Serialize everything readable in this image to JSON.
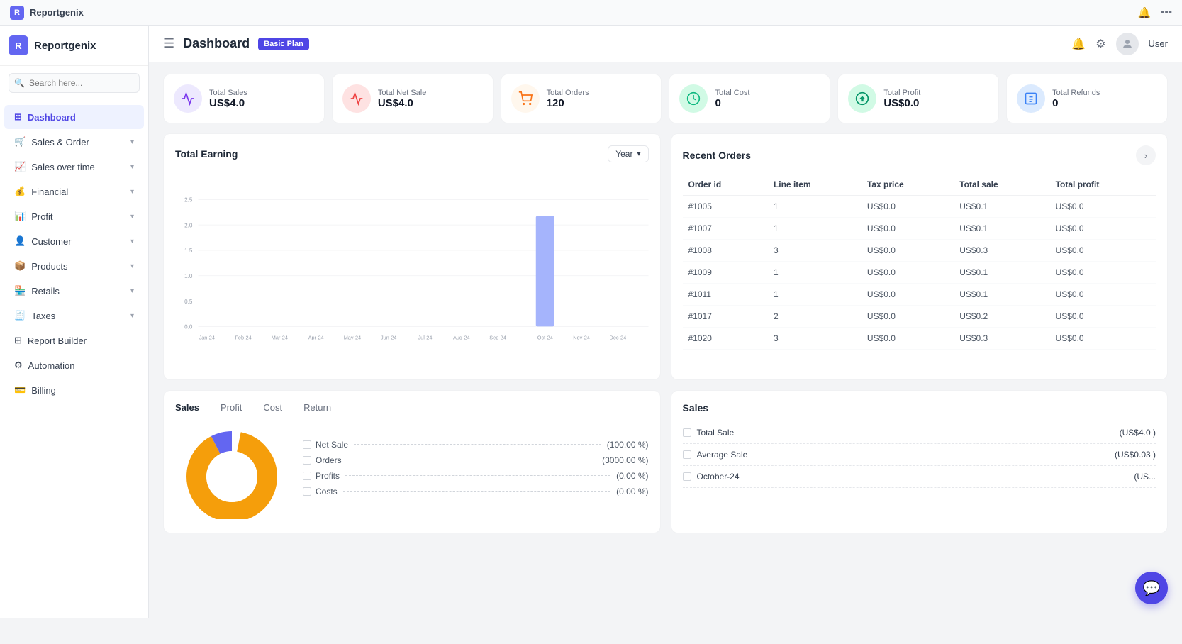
{
  "app": {
    "name": "Reportgenix",
    "logo_letter": "R"
  },
  "window_topbar": {
    "brand": "Reportgenix",
    "icons": [
      "bell",
      "dots"
    ]
  },
  "sidebar": {
    "search_placeholder": "Search here...",
    "items": [
      {
        "id": "dashboard",
        "label": "Dashboard",
        "icon": "⊞",
        "active": true,
        "has_chevron": false
      },
      {
        "id": "sales-order",
        "label": "Sales & Order",
        "icon": "🛒",
        "active": false,
        "has_chevron": true
      },
      {
        "id": "sales-over-time",
        "label": "Sales over time",
        "icon": "📈",
        "active": false,
        "has_chevron": true
      },
      {
        "id": "financial",
        "label": "Financial",
        "icon": "💰",
        "active": false,
        "has_chevron": true
      },
      {
        "id": "profit",
        "label": "Profit",
        "icon": "📊",
        "active": false,
        "has_chevron": true
      },
      {
        "id": "customer",
        "label": "Customer",
        "icon": "👤",
        "active": false,
        "has_chevron": true
      },
      {
        "id": "products",
        "label": "Products",
        "icon": "📦",
        "active": false,
        "has_chevron": true
      },
      {
        "id": "retails",
        "label": "Retails",
        "icon": "🏪",
        "active": false,
        "has_chevron": true
      },
      {
        "id": "taxes",
        "label": "Taxes",
        "icon": "🧾",
        "active": false,
        "has_chevron": true
      },
      {
        "id": "report-builder",
        "label": "Report Builder",
        "icon": "⊞",
        "active": false,
        "has_chevron": false
      },
      {
        "id": "automation",
        "label": "Automation",
        "icon": "⚙",
        "active": false,
        "has_chevron": false
      },
      {
        "id": "billing",
        "label": "Billing",
        "icon": "💳",
        "active": false,
        "has_chevron": false
      }
    ]
  },
  "topbar": {
    "hamburger": "☰",
    "title": "Dashboard",
    "plan_badge": "Basic Plan",
    "bell_icon": "🔔",
    "gear_icon": "⚙",
    "user_name": "User"
  },
  "stats": [
    {
      "id": "total-sales",
      "label": "Total Sales",
      "value": "US$4.0",
      "icon": "📊",
      "color": "purple"
    },
    {
      "id": "total-net-sale",
      "label": "Total Net Sale",
      "value": "US$4.0",
      "icon": "📣",
      "color": "red"
    },
    {
      "id": "total-orders",
      "label": "Total Orders",
      "value": "120",
      "icon": "🛒",
      "color": "orange"
    },
    {
      "id": "total-cost",
      "label": "Total Cost",
      "value": "0",
      "icon": "💵",
      "color": "green"
    },
    {
      "id": "total-profit",
      "label": "Total Profit",
      "value": "US$0.0",
      "icon": "💰",
      "color": "teal"
    },
    {
      "id": "total-refunds",
      "label": "Total Refunds",
      "value": "0",
      "icon": "📋",
      "color": "blue"
    }
  ],
  "total_earning": {
    "title": "Total Earning",
    "period_label": "Year",
    "y_labels": [
      "2.5",
      "2.0",
      "1.5",
      "1.0",
      "0.5",
      "0.0"
    ],
    "x_labels": [
      "Jan-24",
      "Feb-24",
      "Mar-24",
      "Apr-24",
      "May-24",
      "Jun-24",
      "Jul-24",
      "Aug-24",
      "Sep-24",
      "Oct-24",
      "Nov-24",
      "Dec-24"
    ],
    "bar_month": "Oct-24",
    "bar_color": "#a5b4fc"
  },
  "recent_orders": {
    "title": "Recent Orders",
    "columns": [
      "Order id",
      "Line item",
      "Tax price",
      "Total sale",
      "Total profit"
    ],
    "rows": [
      {
        "order_id": "#1005",
        "line_item": "1",
        "tax_price": "US$0.0",
        "total_sale": "US$0.1",
        "total_profit": "US$0.0"
      },
      {
        "order_id": "#1007",
        "line_item": "1",
        "tax_price": "US$0.0",
        "total_sale": "US$0.1",
        "total_profit": "US$0.0"
      },
      {
        "order_id": "#1008",
        "line_item": "3",
        "tax_price": "US$0.0",
        "total_sale": "US$0.3",
        "total_profit": "US$0.0"
      },
      {
        "order_id": "#1009",
        "line_item": "1",
        "tax_price": "US$0.0",
        "total_sale": "US$0.1",
        "total_profit": "US$0.0"
      },
      {
        "order_id": "#1011",
        "line_item": "1",
        "tax_price": "US$0.0",
        "total_sale": "US$0.1",
        "total_profit": "US$0.0"
      },
      {
        "order_id": "#1017",
        "line_item": "2",
        "tax_price": "US$0.0",
        "total_sale": "US$0.2",
        "total_profit": "US$0.0"
      },
      {
        "order_id": "#1020",
        "line_item": "3",
        "tax_price": "US$0.0",
        "total_sale": "US$0.3",
        "total_profit": "US$0.0"
      }
    ]
  },
  "sales_donut": {
    "title": "Sales",
    "sub_headers": [
      "Sales",
      "Profit",
      "Cost",
      "Return"
    ],
    "legend": [
      {
        "label": "Net Sale",
        "value": "(100.00 %)"
      },
      {
        "label": "Orders",
        "value": "(3000.00 %)"
      },
      {
        "label": "Profits",
        "value": "(0.00 %)"
      },
      {
        "label": "Costs",
        "value": "(0.00 %)"
      }
    ],
    "donut_colors": [
      "#f59e0b",
      "#6366f1"
    ]
  },
  "sales_right": {
    "title": "Sales",
    "items": [
      {
        "label": "Total Sale",
        "value": "(US$4.0 )"
      },
      {
        "label": "Average Sale",
        "value": "(US$0.03 )"
      },
      {
        "label": "October-24",
        "value": "(US..."
      }
    ]
  },
  "chat_bubble": "💬"
}
